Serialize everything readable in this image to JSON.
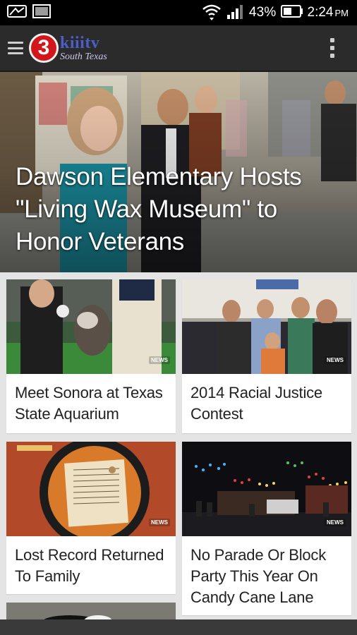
{
  "status_bar": {
    "battery_percent": "43%",
    "time": "2:24",
    "ampm": "PM"
  },
  "app_bar": {
    "logo_number": "3",
    "logo_text": "kiiitv",
    "logo_subtext": "South Texas",
    "colors": {
      "background": "#2b2b2b",
      "logo_red": "#d3161c",
      "logo_blue": "#4a5fc7"
    }
  },
  "hero": {
    "title": "Dawson Elementary Hosts \"Living Wax Museum\" to Honor Veterans"
  },
  "cards": [
    {
      "title": "Meet Sonora at Texas State Aquarium",
      "badge": "NEWS"
    },
    {
      "title": "2014 Racial Justice Contest",
      "badge": "NEWS"
    },
    {
      "title": "Lost Record Returned To Family",
      "badge": "NEWS"
    },
    {
      "title": "No Parade Or Block Party This Year On Candy Cane Lane",
      "badge": "NEWS"
    }
  ]
}
